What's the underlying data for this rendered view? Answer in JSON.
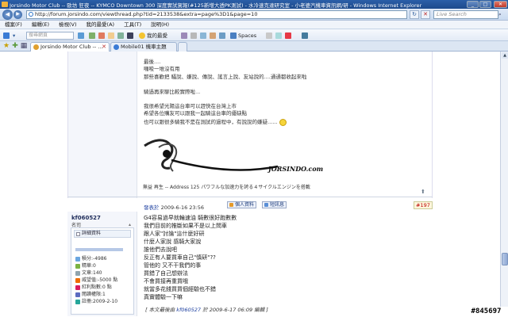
{
  "window": {
    "title": "Jorsindo Motor Club -- 歐坊 狂夜 -- KYMCO Downtown 300 深度實試駕報(#125新增大透PK測試) - 水冷速克達研究室 - 小老婆汽機車資訊網/研 - Windows Internet Explorer",
    "min_label": "_",
    "max_label": "□",
    "close_label": "✕"
  },
  "address": {
    "url": "http://forum.jorsindo.com/viewthread.php?tid=2133538&extra=page%3D1&page=10",
    "refresh_label": "↻",
    "stop_label": "✕",
    "search_placeholder": "Live Search",
    "back_label": "◀",
    "forward_label": "▶"
  },
  "menu": [
    "檔案(F)",
    "編輯(E)",
    "檢視(V)",
    "我的最愛(A)",
    "工具(T)",
    "說明(H)"
  ],
  "toolbar": {
    "search_placeholder": "搜尋網頁",
    "favorites_label": "我的最愛",
    "spaces_label": "Spaces"
  },
  "tabs": [
    {
      "label": "Jorsindo Motor Club -- ..."
    },
    {
      "label": "Mobile01 機車主題"
    }
  ],
  "postA": {
    "lines": [
      "最後....",
      "囉唆一堆沒有用",
      "那些喜歡把 騷說、嫌說、傳說、謠言上說、友站說的....通通都收起來啦",
      "騎過再來聊比較實際啦...",
      "我很希望光陽這台車可以趕快在台灣上市",
      "希望各位購友可以跟我一起騎這台車的優缺點",
      "也可以跟很多騎我不是在測試的過程中，有說說的嫌疑......"
    ],
    "logo_text": "JORSINDO.com",
    "sig_line": "無益 再生 -- Address 125 パワフルな加速力を誇る４サイクルエンジンを搭載",
    "time_label": "TOP"
  },
  "postB": {
    "post_date": "2009-6-16 23:56",
    "poster_label": "發表於",
    "btn_profile": "個人資料",
    "btn_pm": "短訊息",
    "post_number": "#197",
    "user": {
      "name": "kf060527",
      "title": "名司",
      "panel_title": "詳細資料",
      "stats": [
        {
          "label": "積分",
          "value": "-4986"
        },
        {
          "label": "精華",
          "value": "0"
        },
        {
          "label": "文章",
          "value": "140"
        },
        {
          "label": "威望值",
          "value": "-5000 點"
        },
        {
          "label": "紅利點數",
          "value": "0 點"
        },
        {
          "label": "閱讀權限",
          "value": "1"
        },
        {
          "label": "註冊",
          "value": "2009-2-10"
        }
      ]
    },
    "lines": [
      "G4容易過早就輪速油 騎數很好跑數數",
      "我們目前的推斷如果不是以上問車",
      "跟人家\"討論\"這什麼好研",
      "什麼人家說 感騎大家說",
      "誰他們去說吧",
      "反正有人要買車自己\"慎研\"??",
      "管他的 又不干我們的事",
      "買錯了自己想辦法",
      "不會買接再重買哦",
      "就當多花錢買買個經驗也不錯",
      "真實體驗一下嘛"
    ],
    "edit_note_prefix": "[ 本文最後由",
    "edit_note_user": "kf060527",
    "edit_note_suffix": "於 2009-6-17 06:09 編輯 ]"
  },
  "badge": "#845697",
  "icons": {
    "smiley": "smiley-icon",
    "ie": "ie-icon",
    "search": "search-icon"
  }
}
